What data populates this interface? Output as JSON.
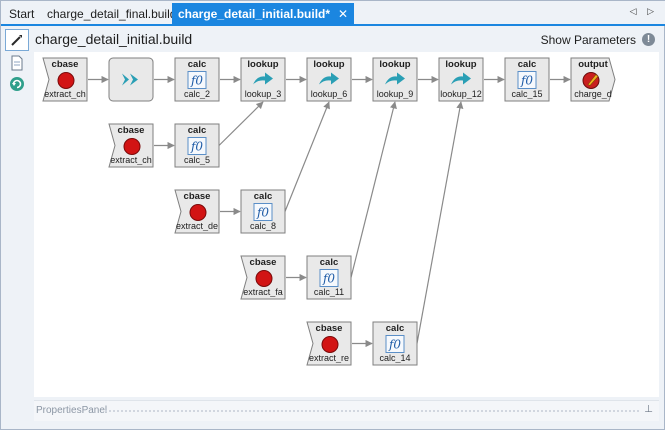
{
  "tabs": [
    {
      "label": "Start"
    },
    {
      "label": "charge_detail_final.build*"
    },
    {
      "label": "charge_detail_initial.build*",
      "active": true
    }
  ],
  "tab_close_glyph": "✕",
  "tab_nav_glyph": "◁ ▷",
  "toolbar": [
    {
      "icon": "pointer-tool-icon"
    },
    {
      "icon": "document-icon"
    },
    {
      "icon": "refresh-icon"
    }
  ],
  "document": {
    "title": "charge_detail_initial.build",
    "show_parameters_label": "Show Parameters",
    "info_glyph": "!"
  },
  "nodes": [
    {
      "id": "n1",
      "type": "cbase",
      "label": "extract_ch",
      "kind": "source"
    },
    {
      "id": "n2",
      "type": "",
      "label": "",
      "kind": "merge"
    },
    {
      "id": "n3",
      "type": "calc",
      "label": "calc_2",
      "kind": "calc"
    },
    {
      "id": "n4",
      "type": "lookup",
      "label": "lookup_3",
      "kind": "lookup"
    },
    {
      "id": "n5",
      "type": "lookup",
      "label": "lookup_6",
      "kind": "lookup"
    },
    {
      "id": "n6",
      "type": "lookup",
      "label": "lookup_9",
      "kind": "lookup"
    },
    {
      "id": "n7",
      "type": "lookup",
      "label": "lookup_12",
      "kind": "lookup"
    },
    {
      "id": "n8",
      "type": "calc",
      "label": "calc_15",
      "kind": "calc"
    },
    {
      "id": "n9",
      "type": "output",
      "label": "charge_d",
      "kind": "output"
    },
    {
      "id": "n10",
      "type": "cbase",
      "label": "extract_ch",
      "kind": "source"
    },
    {
      "id": "n11",
      "type": "calc",
      "label": "calc_5",
      "kind": "calc"
    },
    {
      "id": "n12",
      "type": "cbase",
      "label": "extract_de",
      "kind": "source"
    },
    {
      "id": "n13",
      "type": "calc",
      "label": "calc_8",
      "kind": "calc"
    },
    {
      "id": "n14",
      "type": "cbase",
      "label": "extract_fa",
      "kind": "source"
    },
    {
      "id": "n15",
      "type": "calc",
      "label": "calc_11",
      "kind": "calc"
    },
    {
      "id": "n16",
      "type": "cbase",
      "label": "extract_re",
      "kind": "source"
    },
    {
      "id": "n17",
      "type": "calc",
      "label": "calc_14",
      "kind": "calc"
    }
  ],
  "edges": [
    [
      "n1",
      "n2"
    ],
    [
      "n2",
      "n3"
    ],
    [
      "n3",
      "n4"
    ],
    [
      "n4",
      "n5"
    ],
    [
      "n5",
      "n6"
    ],
    [
      "n6",
      "n7"
    ],
    [
      "n7",
      "n8"
    ],
    [
      "n8",
      "n9"
    ],
    [
      "n10",
      "n11"
    ],
    [
      "n11",
      "n4"
    ],
    [
      "n12",
      "n13"
    ],
    [
      "n13",
      "n5"
    ],
    [
      "n14",
      "n15"
    ],
    [
      "n15",
      "n6"
    ],
    [
      "n16",
      "n17"
    ],
    [
      "n17",
      "n7"
    ]
  ],
  "calc_glyph": "f0",
  "properties_panel": {
    "label": "PropertiesPanel",
    "pin_glyph": "⊥"
  },
  "colors": {
    "accent": "#1b86e0",
    "node_fill": "#e9e9e9",
    "node_border": "#7f7f7f",
    "source_dot": "#d21414",
    "lookup_arrow": "#2a9fb5",
    "edge": "#8a8a8a"
  }
}
